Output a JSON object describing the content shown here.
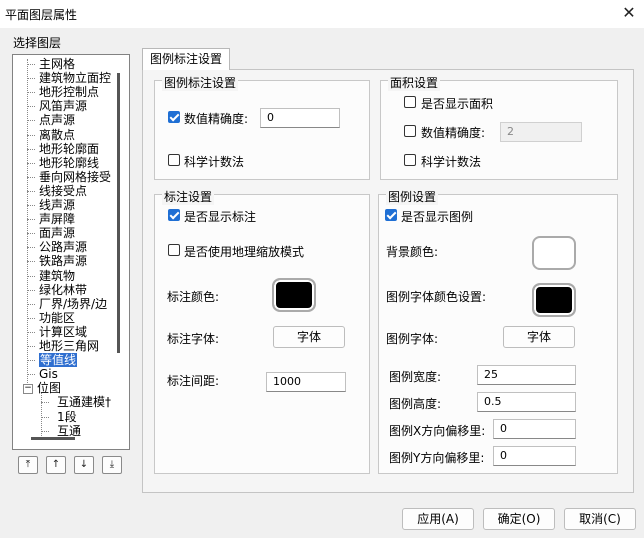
{
  "window": {
    "title": "平面图层属性",
    "close_glyph": "✕"
  },
  "layer_group": {
    "label": "选择图层"
  },
  "tree": {
    "items": [
      "主网格",
      "建筑物立面控",
      "地形控制点",
      "风笛声源",
      "点声源",
      "离散点",
      "地形轮廓面",
      "地形轮廓线",
      "垂向网格接受",
      "线接受点",
      "线声源",
      "声屏障",
      "面声源",
      "公路声源",
      "铁路声源",
      "建筑物",
      "绿化林带",
      "厂界/场界/边",
      "功能区",
      "计算区域",
      "地形三角网",
      "等值线"
    ],
    "selected_index": 21,
    "gis": "Gis",
    "position": "位图",
    "sub_items": [
      "互通建模†",
      "1段",
      "互通"
    ]
  },
  "nav_buttons": {
    "top": "⤒",
    "up": "↑",
    "down": "↓",
    "bottom": "⤓"
  },
  "tab": {
    "label": "图例标注设置"
  },
  "legend_label_settings": {
    "title": "图例标注设置",
    "precision_label": "数值精确度:",
    "precision_checked": true,
    "precision_value": "0",
    "sci_label": "科学计数法",
    "sci_checked": false
  },
  "area_settings": {
    "title": "面积设置",
    "show_area_label": "是否显示面积",
    "show_area_checked": false,
    "precision_label": "数值精确度:",
    "precision_checked": false,
    "precision_value": "2",
    "sci_label": "科学计数法",
    "sci_checked": false
  },
  "label_settings": {
    "title": "标注设置",
    "show_label": "是否显示标注",
    "show_checked": true,
    "geo_scale_label": "是否使用地理缩放模式",
    "geo_scale_checked": false,
    "color_label": "标注颜色:",
    "color": "#000000",
    "font_label": "标注字体:",
    "font_button": "字体",
    "spacing_label": "标注间距:",
    "spacing_value": "1000"
  },
  "legend_settings": {
    "title": "图例设置",
    "show_legend": "是否显示图例",
    "show_checked": true,
    "bg_color_label": "背景颜色:",
    "bg_color": "#ffffff",
    "font_color_label": "图例字体颜色设置:",
    "font_color": "#000000",
    "font_label": "图例字体:",
    "font_button": "字体",
    "width_label": "图例宽度:",
    "width_value": "25",
    "height_label": "图例高度:",
    "height_value": "0.5",
    "x_offset_label": "图例X方向偏移里:",
    "x_offset_value": "0",
    "y_offset_label": "图例Y方向偏移里:",
    "y_offset_value": "0"
  },
  "footer": {
    "apply": "应用(A)",
    "ok": "确定(O)",
    "cancel": "取消(C)"
  },
  "colors": {
    "accent": "#1f6fd4",
    "selected": "#2f6fd0"
  }
}
